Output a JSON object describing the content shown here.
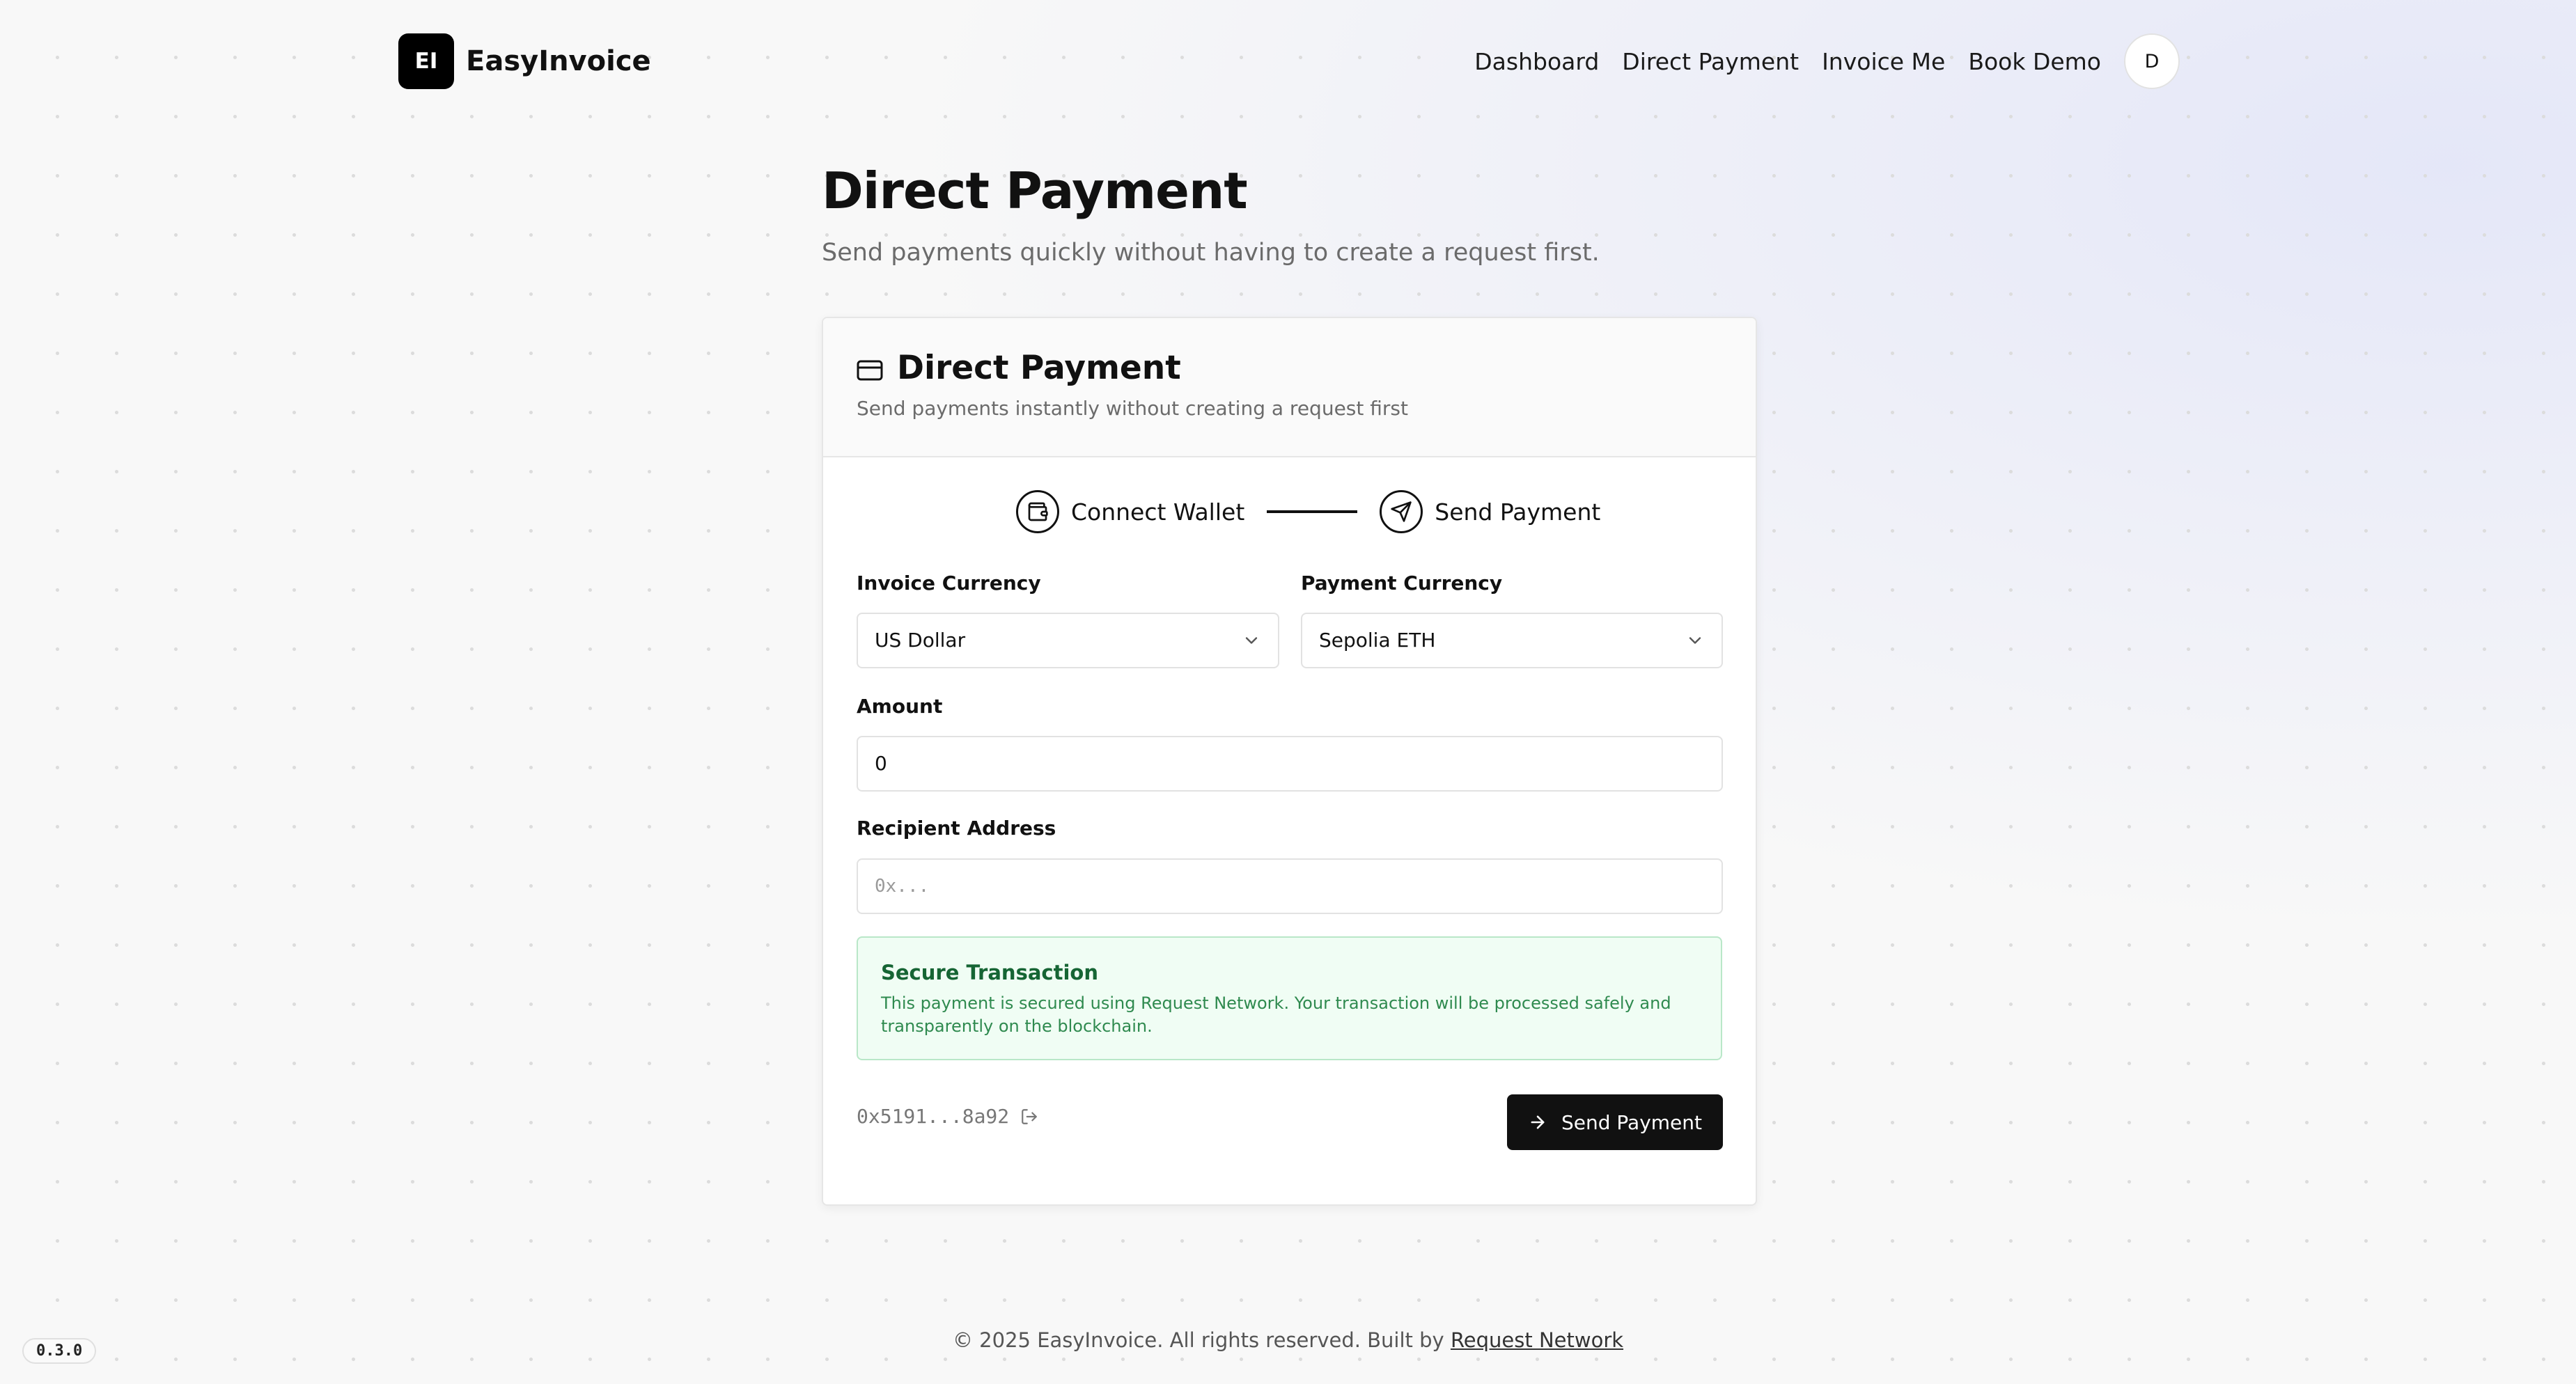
{
  "brand": {
    "logo_initials": "EI",
    "name": "EasyInvoice"
  },
  "nav": {
    "links": [
      "Dashboard",
      "Direct Payment",
      "Invoice Me",
      "Book Demo"
    ],
    "avatar_initial": "D"
  },
  "page": {
    "title": "Direct Payment",
    "subtitle": "Send payments quickly without having to create a request first."
  },
  "card": {
    "title": "Direct Payment",
    "description": "Send payments instantly without creating a request first",
    "title_icon": "credit-card-icon"
  },
  "stepper": {
    "steps": [
      {
        "label": "Connect Wallet",
        "icon": "wallet-icon"
      },
      {
        "label": "Send Payment",
        "icon": "send-icon"
      }
    ]
  },
  "form": {
    "invoice_currency": {
      "label": "Invoice Currency",
      "value": "US Dollar"
    },
    "payment_currency": {
      "label": "Payment Currency",
      "value": "Sepolia ETH"
    },
    "amount": {
      "label": "Amount",
      "value": "0"
    },
    "recipient": {
      "label": "Recipient Address",
      "placeholder": "0x...",
      "value": ""
    }
  },
  "secure": {
    "title": "Secure Transaction",
    "text": "This payment is secured using Request Network. Your transaction will be processed safely and transparently on the blockchain."
  },
  "wallet": {
    "address": "0x5191...8a92"
  },
  "actions": {
    "send_label": "Send Payment"
  },
  "footer": {
    "text": "© 2025 EasyInvoice. All rights reserved. Built by",
    "link": "Request Network"
  },
  "version": "0.3.0",
  "colors": {
    "primary": "#111111",
    "secure_bg": "#f0fdf4",
    "secure_border": "#b9e7c8",
    "secure_title": "#166534",
    "secure_text": "#2f8a4f"
  }
}
